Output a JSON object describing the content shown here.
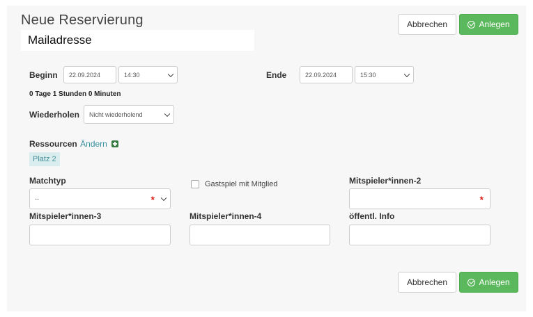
{
  "header": {
    "title": "Neue Reservierung",
    "email": "Mailadresse",
    "cancel_label": "Abbrechen",
    "create_label": "Anlegen"
  },
  "time": {
    "begin_label": "Beginn",
    "begin_date": "22.09.2024",
    "begin_time": "14:30",
    "end_label": "Ende",
    "end_date": "22.09.2024",
    "end_time": "15:30",
    "duration": "0 Tage 1 Stunden 0 Minuten"
  },
  "repeat": {
    "label": "Wiederholen",
    "value": "Nicht wiederholend"
  },
  "resources": {
    "label": "Ressourcen",
    "change_link": "Ändern",
    "tag": "Platz 2"
  },
  "form": {
    "matchtyp_label": "Matchtyp",
    "matchtyp_value": "--",
    "guest_label": "Gastspiel mit Mitglied",
    "player2_label": "Mitspieler*innen-2",
    "player3_label": "Mitspieler*innen-3",
    "player4_label": "Mitspieler*innen-4",
    "info_label": "öffentl. Info",
    "required_marker": "*"
  },
  "footer": {
    "cancel_label": "Abbrechen",
    "create_label": "Anlegen"
  },
  "colors": {
    "primary_green": "#5cb85c",
    "link_teal": "#3a8fa0",
    "required_red": "#d9231d"
  }
}
